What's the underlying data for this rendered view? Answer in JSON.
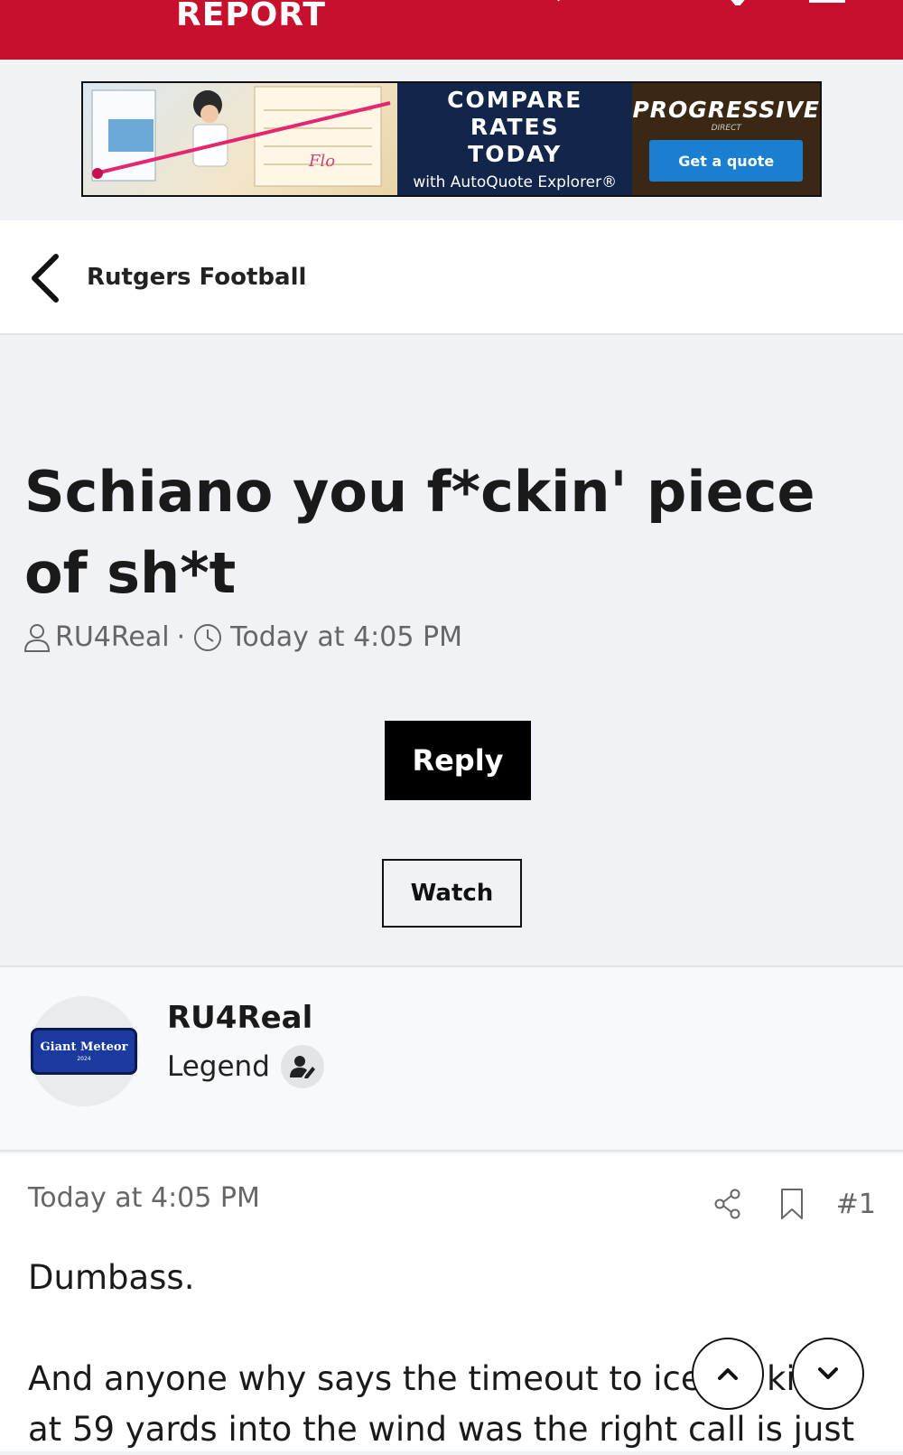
{
  "header": {
    "brand": "REPORT",
    "brand_color": "#c8102e"
  },
  "ad": {
    "headline": "COMPARE RATES TODAY",
    "subline": "with AutoQuote Explorer®",
    "sponsor": "PROGRESSIVE",
    "sponsor_sub": "DIRECT",
    "cta": "Get a quote",
    "character": "Flo"
  },
  "breadcrumb": {
    "label": "Rutgers Football"
  },
  "thread": {
    "title": "Schiano you f*ckin' piece of sh*t",
    "author": "RU4Real",
    "meta_sep": "·",
    "time": "Today at 4:05 PM",
    "reply_label": "Reply",
    "watch_label": "Watch"
  },
  "author_card": {
    "name": "RU4Real",
    "role": "Legend",
    "avatar_text": "Giant Meteor",
    "avatar_year": "2024"
  },
  "post": {
    "time": "Today at 4:05 PM",
    "number": "#1",
    "paragraph1": "Dumbass.",
    "paragraph2_line1": "And anyone why says the timeout to ice",
    "paragraph2_frag": "ki",
    "paragraph2_line2": "at 59 yards into the wind was the right call is just"
  },
  "icons": {
    "back": "chevron-left-icon",
    "user": "user-icon",
    "clock": "clock-icon",
    "share": "share-icon",
    "bookmark": "bookmark-icon",
    "scroll_up": "chevron-up-icon",
    "scroll_down": "chevron-down-icon",
    "role": "user-edit-icon"
  }
}
